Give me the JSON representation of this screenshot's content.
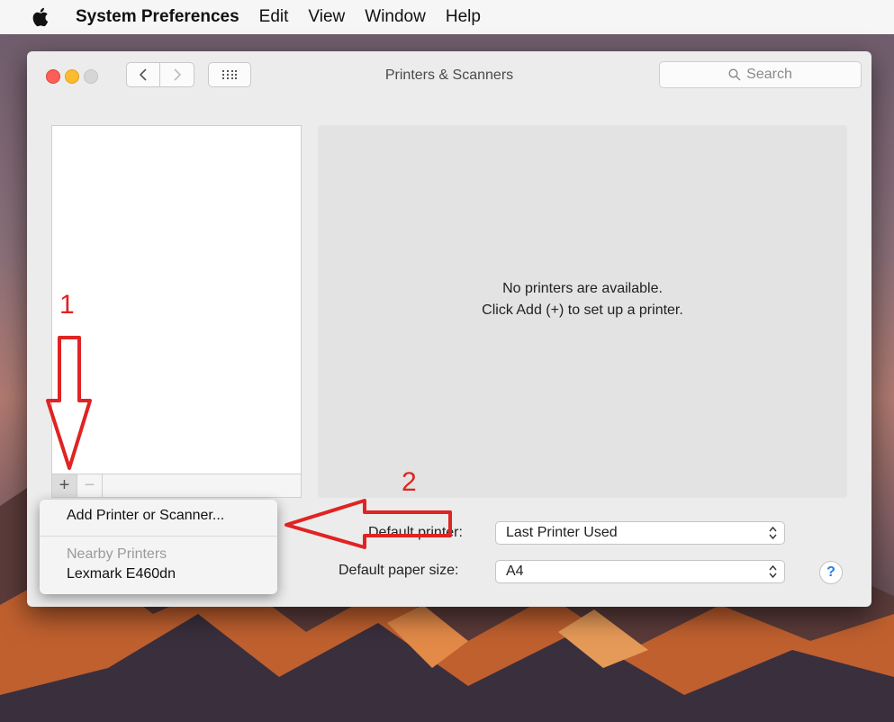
{
  "menubar": {
    "app_name": "System Preferences",
    "items": [
      "Edit",
      "View",
      "Window",
      "Help"
    ]
  },
  "window": {
    "title": "Printers & Scanners",
    "search_placeholder": "Search",
    "back_icon": "chevron-left-icon",
    "forward_icon": "chevron-right-icon",
    "grid_icon": "grid-icon"
  },
  "printer_list": {
    "add_label": "+",
    "remove_label": "−"
  },
  "detail": {
    "message_line1": "No printers are available.",
    "message_line2": "Click Add (+) to set up a printer."
  },
  "settings": {
    "default_printer_label": "Default printer:",
    "default_printer_value": "Last Printer Used",
    "paper_size_label": "Default paper size:",
    "paper_size_value": "A4",
    "help_label": "?"
  },
  "add_menu": {
    "add_item": "Add Printer or Scanner...",
    "nearby_header": "Nearby Printers",
    "nearby_printer": "Lexmark E460dn"
  },
  "annotations": {
    "step1": "1",
    "step2": "2",
    "color": "#e02323"
  }
}
